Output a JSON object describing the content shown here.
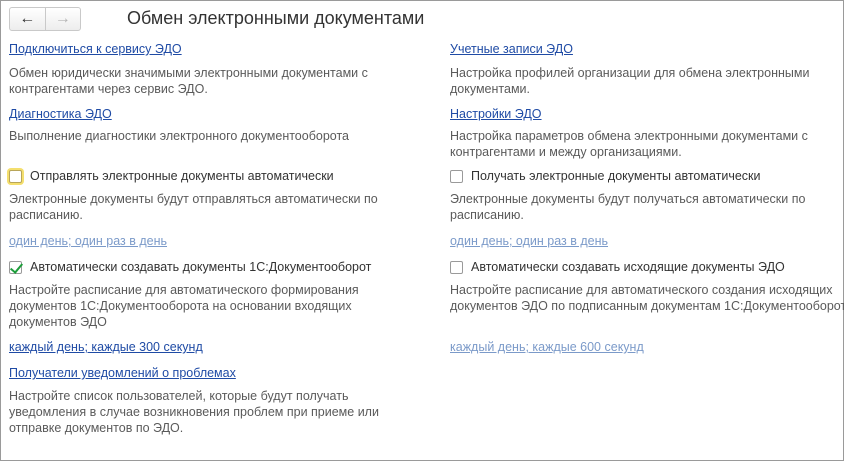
{
  "window": {
    "title": "Обмен электронными документами"
  },
  "nav": {
    "back_icon": "arrow-left-icon",
    "forward_icon": "arrow-right-icon"
  },
  "left": {
    "connect_link": "Подключиться к сервису ЭДО",
    "connect_desc": "Обмен юридически значимыми электронными документами с контрагентами через сервис ЭДО.",
    "diag_link": "Диагностика ЭДО",
    "diag_desc": "Выполнение диагностики электронного документооборота",
    "send_auto": {
      "label": "Отправлять электронные документы автоматически",
      "checked": false
    },
    "send_desc": "Электронные документы будут отправляться автоматически по расписанию.",
    "send_schedule": "один день; один раз в день",
    "create_1c": {
      "label": "Автоматически создавать документы 1С:Документооборот",
      "checked": true
    },
    "create_desc": "Настройте расписание для автоматического формирования документов 1С:Документооборота на основании входящих документов ЭДО",
    "create_schedule": "каждый день; каждые 300 секунд",
    "recipients_link": "Получатели уведомлений о проблемах",
    "recipients_desc": "Настройте список пользователей, которые будут получать уведомления в случае возникновения проблем при приеме или отправке документов по ЭДО."
  },
  "right": {
    "accounts_link": "Учетные записи ЭДО",
    "accounts_desc": "Настройка профилей организации для обмена электронными документами.",
    "settings_link": "Настройки ЭДО",
    "settings_desc": "Настройка параметров обмена электронными документами с контрагентами и между организациями.",
    "receive_auto": {
      "label": "Получать электронные документы автоматически",
      "checked": false
    },
    "receive_desc": "Электронные документы будут получаться автоматически по расписанию.",
    "receive_schedule": "один день; один раз в день",
    "create_outgoing": {
      "label": "Автоматически создавать исходящие документы ЭДО",
      "checked": false
    },
    "outgoing_desc": "Настройте расписание для автоматического создания исходящих документов ЭДО по подписанным документам 1С:Документооборот",
    "outgoing_schedule": "каждый день; каждые 600 секунд"
  }
}
